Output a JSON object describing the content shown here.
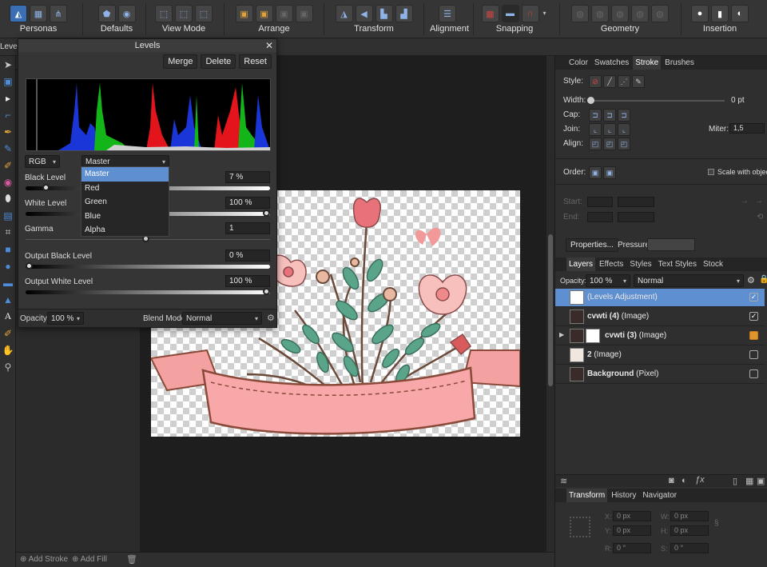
{
  "toolbar": {
    "groups": [
      {
        "label": "Personas"
      },
      {
        "label": "Defaults"
      },
      {
        "label": "View Mode"
      },
      {
        "label": "Arrange"
      },
      {
        "label": "Transform"
      },
      {
        "label": "Alignment"
      },
      {
        "label": "Snapping"
      },
      {
        "label": "Geometry"
      },
      {
        "label": "Insertion"
      }
    ]
  },
  "context": {
    "tool_label": "Level"
  },
  "levels": {
    "title": "Levels",
    "close_glyph": "✕",
    "buttons": {
      "merge": "Merge",
      "delete": "Delete",
      "reset": "Reset"
    },
    "channel_mode": "RGB",
    "channel_dropdown": "Master",
    "channel_options": [
      "Master",
      "Red",
      "Green",
      "Blue",
      "Alpha"
    ],
    "black_level": {
      "label": "Black Level",
      "value": "7 %",
      "fraction": 0.07
    },
    "white_level": {
      "label": "White Level",
      "value": "100 %",
      "fraction": 1.0
    },
    "gamma": {
      "label": "Gamma",
      "value": "1",
      "fraction": 0.49
    },
    "output_black": {
      "label": "Output Black Level",
      "value": "0 %",
      "fraction": 0.0
    },
    "output_white": {
      "label": "Output White Level",
      "value": "100 %",
      "fraction": 1.0
    },
    "opacity_label": "Opacity:",
    "opacity_value": "100 %",
    "blend_label": "Blend Mode:",
    "blend_value": "Normal"
  },
  "stroke_panel": {
    "tabs": [
      "Color",
      "Swatches",
      "Stroke",
      "Brushes"
    ],
    "active_tab": "Stroke",
    "style_label": "Style:",
    "width_label": "Width:",
    "width_value": "0 pt",
    "cap_label": "Cap:",
    "join_label": "Join:",
    "miter_label": "Miter:",
    "miter_value": "1,5",
    "align_label": "Align:",
    "order_label": "Order:",
    "scale_label": "Scale with object",
    "start_label": "Start:",
    "end_label": "End:",
    "properties_button": "Properties...",
    "pressure_label": "Pressure:"
  },
  "layers_panel": {
    "tabs": [
      "Layers",
      "Effects",
      "Styles",
      "Text Styles",
      "Stock"
    ],
    "active_tab": "Layers",
    "opacity_label": "Opacity:",
    "opacity_value": "100 %",
    "blend_value": "Normal",
    "layers": [
      {
        "name": "(Levels Adjustment)",
        "bold": "",
        "kind": "(Levels Adjustment)",
        "checked": "✓"
      },
      {
        "name": "cvwti (4) (Image)",
        "bold": "cvwti (4)",
        "kind": " (Image)",
        "checked": "✓"
      },
      {
        "name": "cvwti (3) (Image)",
        "bold": "cvwti (3)",
        "kind": " (Image)",
        "checked": ""
      },
      {
        "name": "2 (Image)",
        "bold": "2",
        "kind": " (Image)",
        "checked": ""
      },
      {
        "name": "Background (Pixel)",
        "bold": "Background",
        "kind": " (Pixel)",
        "checked": ""
      }
    ]
  },
  "transform_panel": {
    "tabs": [
      "Transform",
      "History",
      "Navigator"
    ],
    "active_tab": "Transform",
    "fields": [
      {
        "label": "X:",
        "value": "0 px"
      },
      {
        "label": "W:",
        "value": "0 px"
      },
      {
        "label": "Y:",
        "value": "0 px"
      },
      {
        "label": "H:",
        "value": "0 px"
      },
      {
        "label": "R:",
        "value": "0 °"
      },
      {
        "label": "S:",
        "value": "0 °"
      }
    ]
  },
  "bottom": {
    "add_stroke": "Add Stroke",
    "add_fill": "Add Fill"
  },
  "colors": {
    "accent": "#5e8fd1",
    "panel": "#2f2f2f",
    "toolbar": "#353535",
    "pink": "#f4a1a1",
    "leaf": "#5aa58a"
  }
}
